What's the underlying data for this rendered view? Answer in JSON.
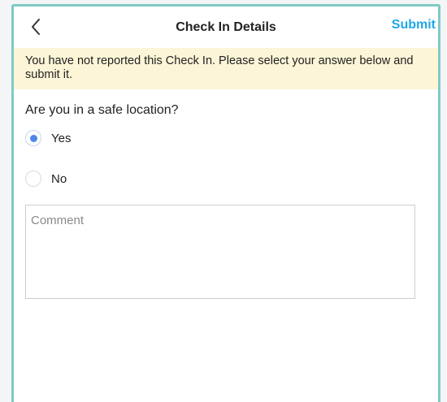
{
  "header": {
    "title": "Check In Details",
    "submit_label": "Submit",
    "back_icon": "chevron-left-icon"
  },
  "banner": {
    "text": "You have not reported this Check In. Please select your answer below and submit it."
  },
  "question": {
    "text": "Are you in a safe location?",
    "options": [
      {
        "label": "Yes",
        "selected": true
      },
      {
        "label": "No",
        "selected": false
      }
    ]
  },
  "comment": {
    "placeholder": "Comment",
    "value": ""
  },
  "colors": {
    "accent": "#1ea8e8",
    "radio_selected": "#4f86e8",
    "banner_bg": "#fdf5d7",
    "frame_border": "#7fcac5"
  }
}
